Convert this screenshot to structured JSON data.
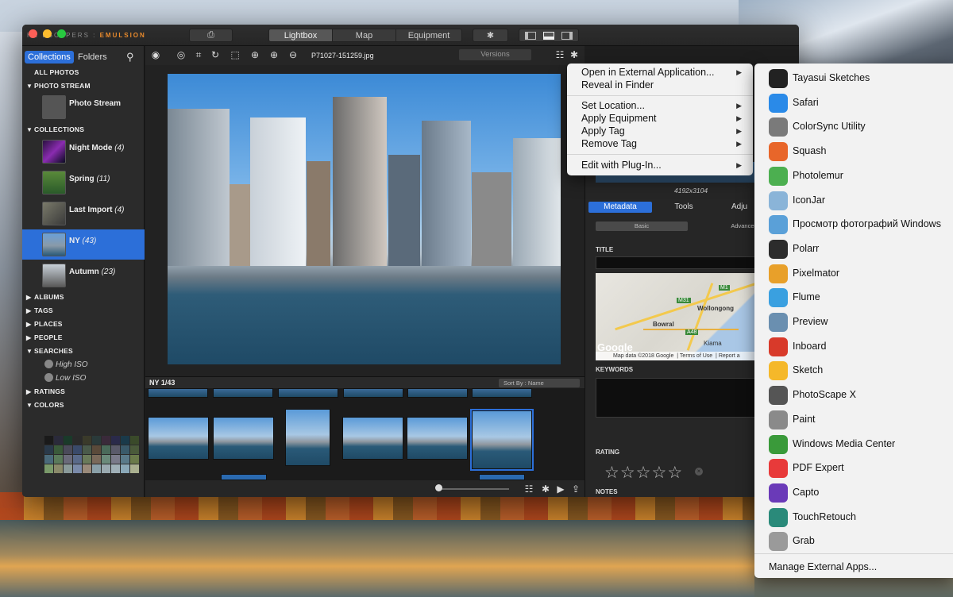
{
  "window": {
    "brand_prefix": "HE ESCAPERS : ",
    "brand_name": "EMULSION"
  },
  "titlebar": {
    "tabs": [
      "Lightbox",
      "Map",
      "Equipment"
    ],
    "active_tab": "Lightbox"
  },
  "sidebar": {
    "tabs": [
      "Collections",
      "Folders"
    ],
    "all_photos": "ALL PHOTOS",
    "photo_stream_header": "PHOTO STREAM",
    "photo_stream_item": "Photo Stream",
    "collections_header": "COLLECTIONS",
    "collections": [
      {
        "name": "Night Mode",
        "count": "(4)"
      },
      {
        "name": "Spring",
        "count": "(11)"
      },
      {
        "name": "Last Import",
        "count": "(4)"
      },
      {
        "name": "NY",
        "count": "(43)"
      },
      {
        "name": "Autumn",
        "count": "(23)"
      }
    ],
    "selected_collection": "NY",
    "sections": [
      "ALBUMS",
      "TAGS",
      "PLACES",
      "PEOPLE",
      "SEARCHES"
    ],
    "searches": [
      "High ISO",
      "Low ISO"
    ],
    "ratings": "RATINGS",
    "colors_header": "COLORS",
    "footer": {
      "minus": "—",
      "plus": "+"
    }
  },
  "toolbar": {
    "filename": "P71027-151259.jpg",
    "versions": "Versions"
  },
  "strip": {
    "title": "NY 1/43",
    "sort": "Sort By : Name"
  },
  "right_panel": {
    "dimensions": "4192x3104",
    "tabs": [
      "Metadata",
      "Tools",
      "Adju"
    ],
    "subtabs": [
      "Basic",
      "Advanced"
    ],
    "title_label": "TITLE",
    "map": {
      "labels": [
        "Bowral",
        "Wollongong",
        "Kiama",
        "M31",
        "M1",
        "A48"
      ],
      "attribution": "Map data ©2018 Google",
      "terms": "Terms of Use",
      "report": "Report a",
      "logo": "Google"
    },
    "keywords_label": "KEYWORDS",
    "rating_label": "RATING",
    "rating_value": 0,
    "notes_label": "NOTES"
  },
  "context_menu": {
    "items": [
      {
        "label": "Open in External Application...",
        "submenu": true
      },
      {
        "label": "Reveal in Finder",
        "submenu": false
      },
      {
        "label": "Set Location...",
        "submenu": true
      },
      {
        "label": "Apply Equipment",
        "submenu": true
      },
      {
        "label": "Apply Tag",
        "submenu": true
      },
      {
        "label": "Remove Tag",
        "submenu": true
      },
      {
        "label": "Edit with Plug-In...",
        "submenu": true
      }
    ]
  },
  "apps_menu": {
    "items": [
      {
        "name": "Tayasui Sketches",
        "icon": "tayasui-icon",
        "color": "#222222"
      },
      {
        "name": "Safari",
        "icon": "safari-icon",
        "color": "#2a8ae8"
      },
      {
        "name": "ColorSync Utility",
        "icon": "colorsync-icon",
        "color": "#7a7a7a"
      },
      {
        "name": "Squash",
        "icon": "squash-icon",
        "color": "#e8662a"
      },
      {
        "name": "Photolemur",
        "icon": "photolemur-icon",
        "color": "#4caf50"
      },
      {
        "name": "IconJar",
        "icon": "iconjar-icon",
        "color": "#8ab4d8"
      },
      {
        "name": "Просмотр фотографий Windows",
        "icon": "windows-photo-icon",
        "color": "#5aa0d8"
      },
      {
        "name": "Polarr",
        "icon": "polarr-icon",
        "color": "#2c2c2c"
      },
      {
        "name": "Pixelmator",
        "icon": "pixelmator-icon",
        "color": "#e8a02a"
      },
      {
        "name": "Flume",
        "icon": "flume-icon",
        "color": "#3aa0e0"
      },
      {
        "name": "Preview",
        "icon": "preview-icon",
        "color": "#6a8fb0"
      },
      {
        "name": "Inboard",
        "icon": "inboard-icon",
        "color": "#d83a2a"
      },
      {
        "name": "Sketch",
        "icon": "sketch-icon",
        "color": "#f5b82a"
      },
      {
        "name": "PhotoScape X",
        "icon": "photoscape-icon",
        "color": "#555555"
      },
      {
        "name": "Paint",
        "icon": "paint-icon",
        "color": "#8a8a8a"
      },
      {
        "name": "Windows Media Center",
        "icon": "media-center-icon",
        "color": "#3a9a3a"
      },
      {
        "name": "PDF Expert",
        "icon": "pdf-expert-icon",
        "color": "#e83a3a"
      },
      {
        "name": "Capto",
        "icon": "capto-icon",
        "color": "#6a3ab8"
      },
      {
        "name": "TouchRetouch",
        "icon": "touchretouch-icon",
        "color": "#2a8a7a"
      },
      {
        "name": "Grab",
        "icon": "grab-icon",
        "color": "#9a9a9a"
      }
    ],
    "manage": "Manage External Apps..."
  }
}
